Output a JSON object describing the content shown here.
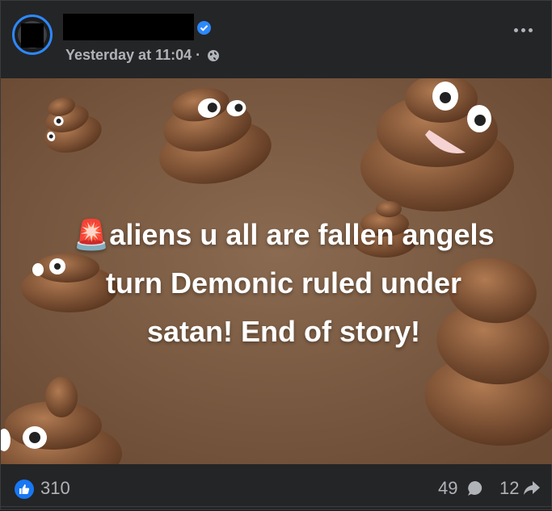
{
  "post": {
    "timestamp": "Yesterday at 11:04 ·",
    "privacy_icon": "globe-icon",
    "more_icon": "more-options-icon",
    "verified_icon": "verified-badge-icon",
    "image_text_lines": [
      "aliens u all are fallen angels",
      "turn Demonic ruled under",
      "satan! End of story!"
    ],
    "image_emoji": "🚨"
  },
  "stats": {
    "likes": "310",
    "comments": "49",
    "shares": "12"
  },
  "colors": {
    "accent": "#2d88ff",
    "like": "#1877f2",
    "card_bg": "#242526",
    "secondary_text": "#b0b3b8",
    "image_bg": "#7a5a42"
  }
}
